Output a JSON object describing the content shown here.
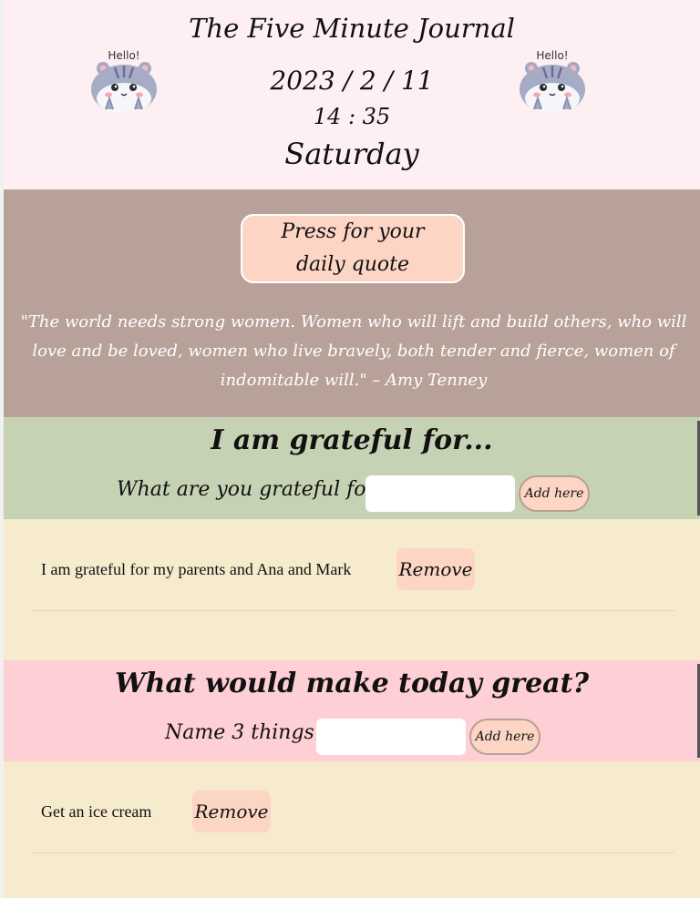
{
  "header": {
    "title": "The Five Minute Journal",
    "date": "2023 / 2 / 11",
    "time": "14 : 35",
    "day": "Saturday",
    "mascot_text": "Hello!"
  },
  "quote_section": {
    "button_label": "Press for your daily quote",
    "quote": "\"The world needs strong women. Women who will lift and build others, who will love and be loved, women who live bravely, both tender and fierce, women of indomitable will.\" – Amy Tenney"
  },
  "grateful": {
    "title": "I am grateful for...",
    "prompt": "What are you grateful for?",
    "input_value": "",
    "add_label": "Add here",
    "items": [
      {
        "text": "I am grateful for my parents and Ana and Mark",
        "remove_label": "Remove"
      }
    ]
  },
  "great": {
    "title": "What would make today great?",
    "prompt": "Name 3 things",
    "input_value": "",
    "add_label": "Add here",
    "items": [
      {
        "text": "Get an ice cream",
        "remove_label": "Remove"
      }
    ]
  },
  "colors": {
    "header_bg": "#fef0f2",
    "quote_bg": "#b8a198",
    "grateful_bg": "#c5d2b3",
    "great_bg": "#fecfd5",
    "list_bg": "#f7ebce",
    "button_bg": "#fdd5c5"
  }
}
